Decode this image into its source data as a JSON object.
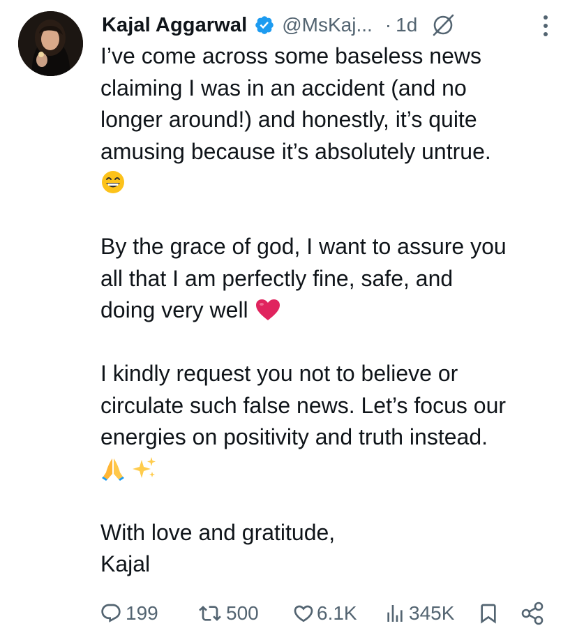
{
  "author": {
    "name": "Kajal Aggarwal",
    "handle": "@MsKaj...",
    "time": "1d",
    "dot": "·"
  },
  "tweet": {
    "lines_p1": [
      "I’ve come across some baseless news",
      "claiming I was in an accident (and no",
      "longer around!) and honestly, it’s quite",
      "amusing because it’s absolutely untrue."
    ],
    "p2_lines": [
      "By the grace of god, I want to assure you",
      "all that I am perfectly fine, safe, and",
      "doing very well"
    ],
    "p3_lines": [
      "I kindly request you not to believe or",
      "circulate such false news. Let’s focus our",
      "energies on positivity and truth instead."
    ],
    "p4_lines": [
      "With love and gratitude,",
      "Kajal"
    ],
    "emoji_grin": "grinning-face-emoji",
    "emoji_heart": "red-heart-emoji",
    "emoji_pray": "folded-hands-emoji",
    "emoji_sparkles": "sparkles-emoji"
  },
  "actions": {
    "replies": "199",
    "reposts": "500",
    "likes": "6.1K",
    "views": "345K"
  },
  "colors": {
    "text": "#0f1419",
    "muted": "#536471",
    "verified": "#1d9bf0",
    "heart": "#e0245e"
  }
}
